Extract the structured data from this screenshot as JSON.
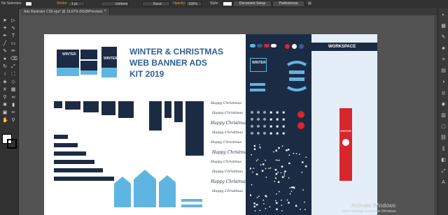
{
  "control_bar": {
    "selection": "No Selection",
    "stroke_label": "Stroke:",
    "stroke_weight": "1 pt",
    "profile": "Uniform",
    "brush": "Basic",
    "opacity_label": "Opacity:",
    "opacity_value": "100%",
    "style_label": "Style:",
    "document_setup": "Document Setup",
    "preferences": "Preferences"
  },
  "document_tab": {
    "title": "Ads Illustrator CS6.eps* @ 16.67% (RGB/Preview)",
    "close": "×"
  },
  "artboard": {
    "title_lines": [
      "WINTER & CHRISTMAS",
      "WEB BANNER ADS",
      "KIT 2019"
    ],
    "script_words": [
      "Happy Christmas",
      "Happy Christmas",
      "Happy Christmas",
      "Happy Christmas",
      "Happy Christmas",
      "Happy Christmas",
      "Happy Christmas",
      "Happy Christmas",
      "Happy Christmas",
      "Happy Christmas"
    ],
    "workspace_label": "WORKSPACE",
    "banner_word": "WINTER"
  },
  "watermark": {
    "line1": "Activate Windows",
    "line2": "Go to Settings to activate Windows."
  },
  "colors": {
    "navy": "#1c2b44",
    "sky": "#5fb5e2",
    "title_blue": "#2f5f96",
    "red": "#d8262d"
  },
  "icons": {
    "tools": [
      "selection-icon",
      "direct-selection-icon",
      "magic-wand-icon",
      "lasso-icon",
      "pen-icon",
      "type-icon",
      "line-icon",
      "rectangle-icon",
      "paintbrush-icon",
      "pencil-icon",
      "blob-brush-icon",
      "eraser-icon",
      "rotate-icon",
      "scale-icon",
      "width-icon",
      "free-transform-icon",
      "shape-builder-icon",
      "perspective-icon",
      "mesh-icon",
      "gradient-icon",
      "eyedropper-icon",
      "blend-icon",
      "symbol-sprayer-icon",
      "column-graph-icon",
      "artboard-icon",
      "slice-icon",
      "hand-icon",
      "zoom-icon"
    ],
    "right_panel": [
      "color-icon",
      "swatches-icon",
      "brushes-icon",
      "symbols-icon",
      "stroke-icon",
      "gradient-panel-icon",
      "transparency-icon",
      "appearance-icon",
      "graphic-styles-icon",
      "layers-icon",
      "artboards-icon",
      "links-icon",
      "align-icon",
      "pathfinder-icon",
      "transform-icon",
      "character-icon"
    ]
  }
}
